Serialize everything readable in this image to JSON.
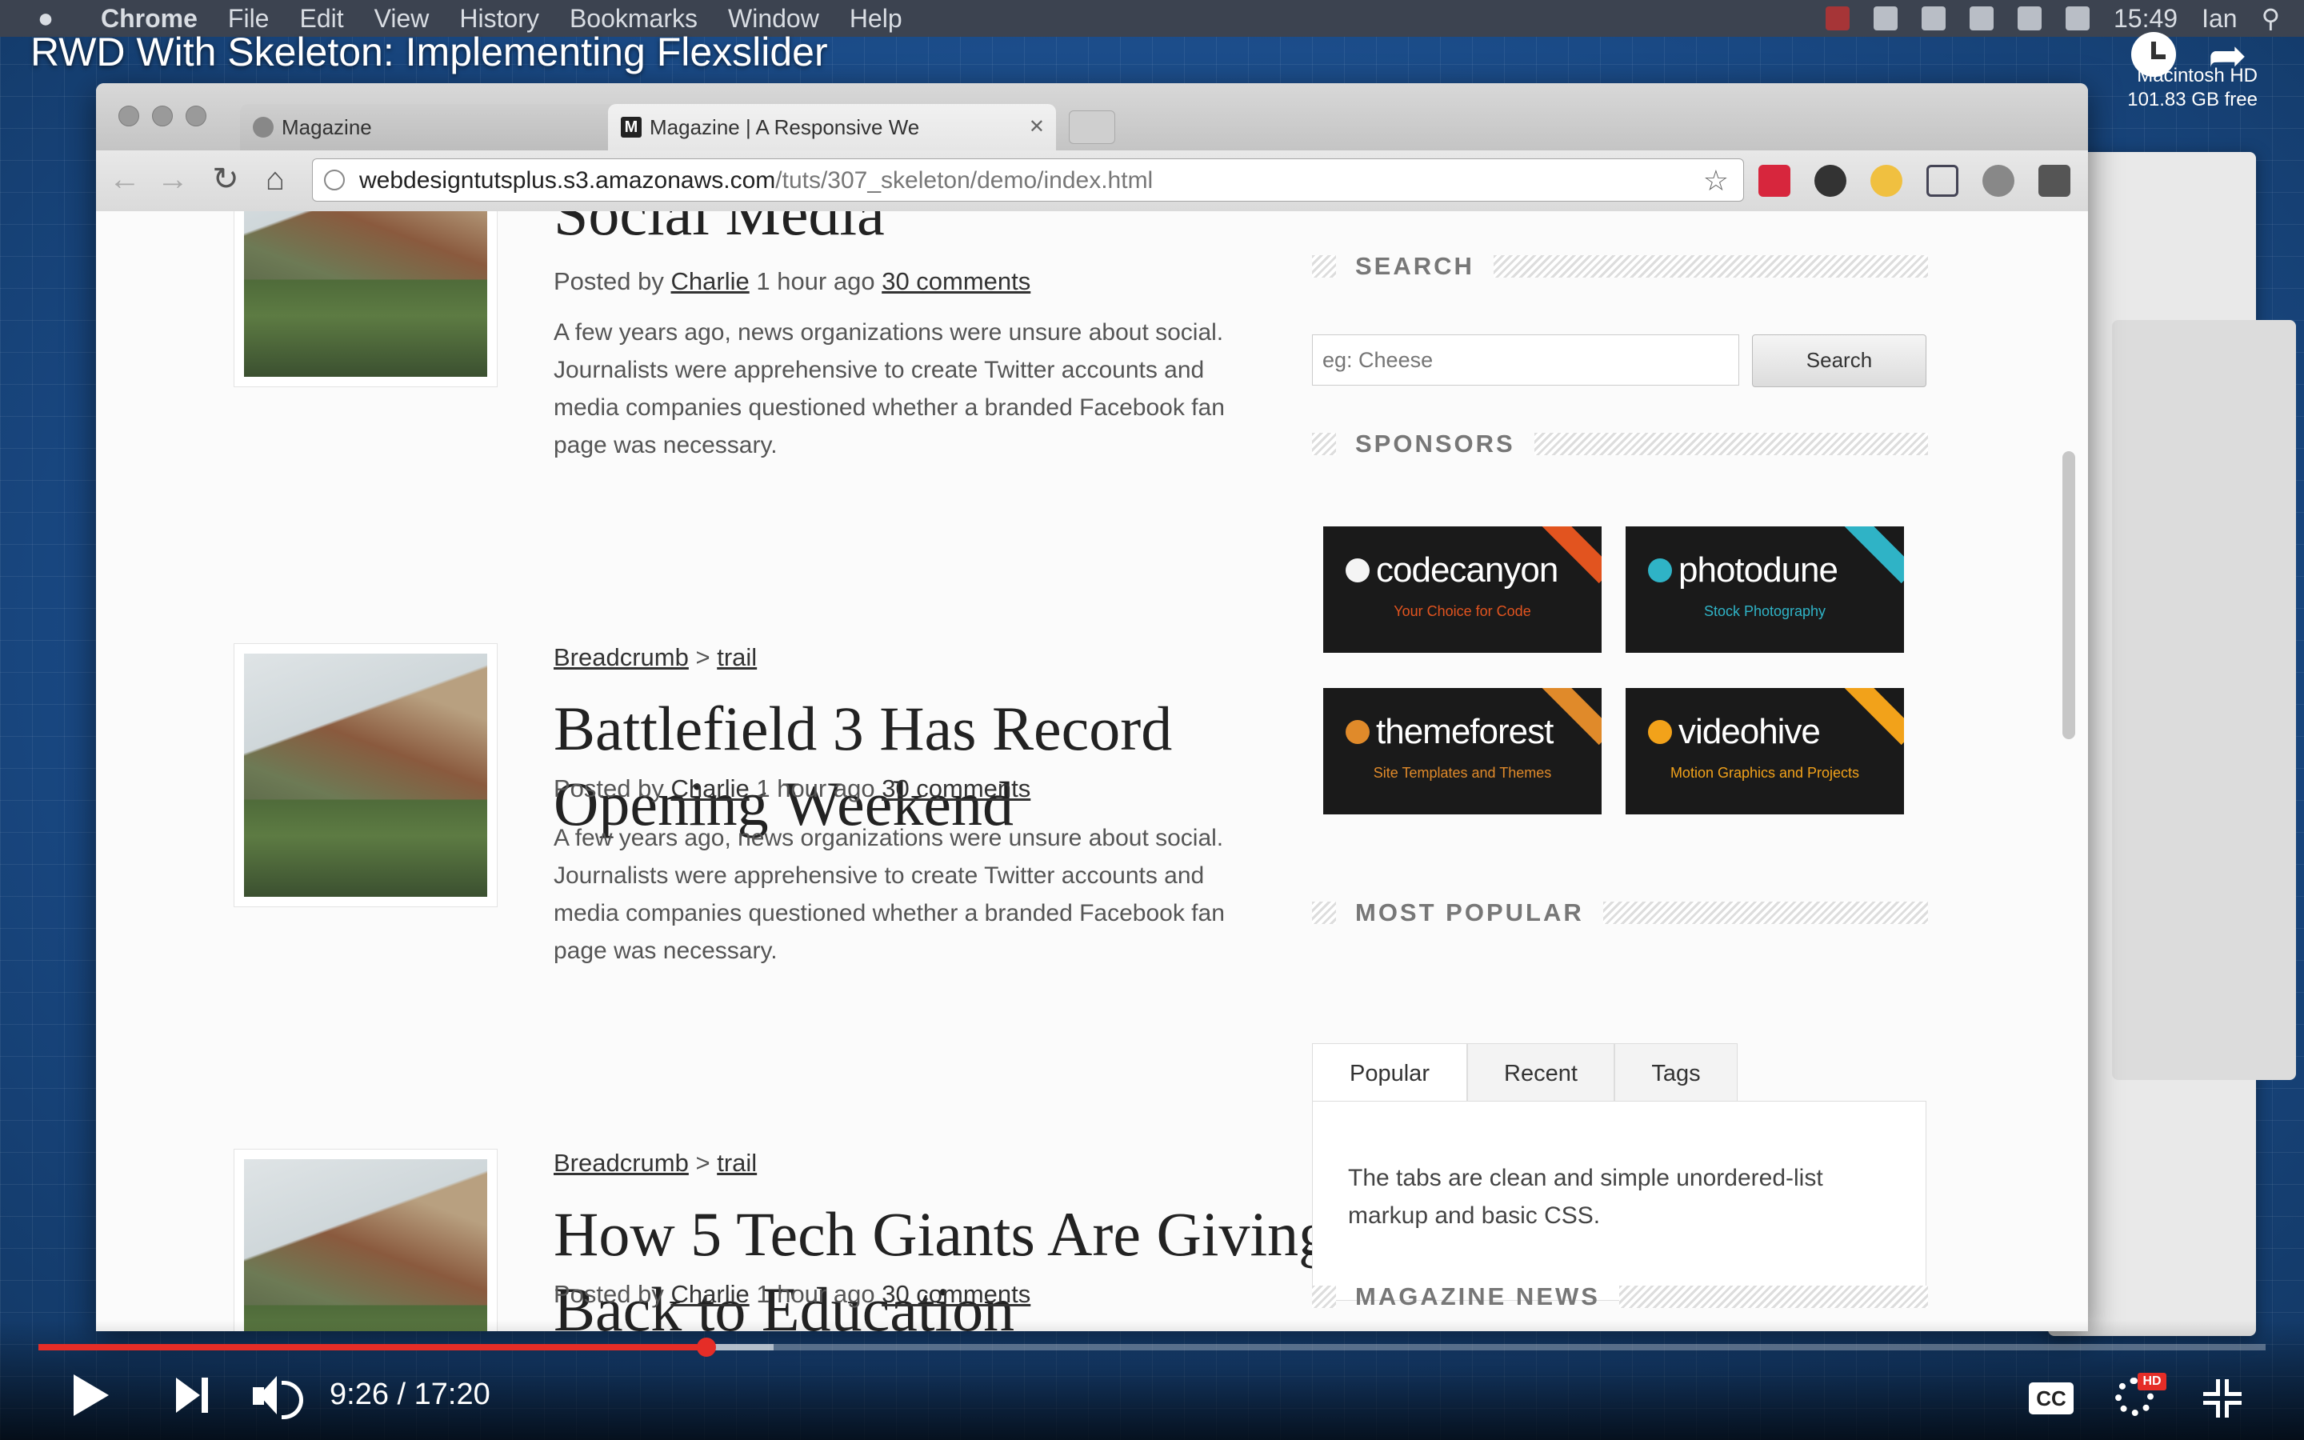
{
  "menubar": {
    "app": "Chrome",
    "items": [
      "File",
      "Edit",
      "View",
      "History",
      "Bookmarks",
      "Window",
      "Help"
    ],
    "clock": "15:49",
    "user": "Ian"
  },
  "video": {
    "title": "RWD With Skeleton: Implementing Flexslider",
    "time": "9:26 / 17:20",
    "played_fraction": 0.3,
    "buffered_fraction": 0.33,
    "cc_label": "CC",
    "hd_label": "HD"
  },
  "desktop": {
    "disk_name": "Macintosh HD",
    "disk_free": "101.83 GB free"
  },
  "browser": {
    "tabs": [
      {
        "title": "Magazine"
      },
      {
        "title": "Magazine | A Responsive We"
      }
    ],
    "url_host": "webdesigntutsplus.s3.amazonaws.com",
    "url_path": "/tuts/307_skeleton/demo/index.html"
  },
  "articles": [
    {
      "title": "Social Media",
      "posted_prefix": "Posted by",
      "author": "Charlie",
      "time": "1 hour ago",
      "comments": "30 comments",
      "excerpt": "A few years ago, news organizations were unsure about social. Journalists were apprehensive to create Twitter accounts and media companies questioned whether a branded Facebook fan page was necessary."
    },
    {
      "crumb_1": "Breadcrumb",
      "crumb_sep": ">",
      "crumb_2": "trail",
      "title": "Battlefield 3 Has Record Opening Weekend",
      "posted_prefix": "Posted by",
      "author": "Charlie",
      "time": "1 hour ago",
      "comments": "30 comments",
      "excerpt": "A few years ago, news organizations were unsure about social. Journalists were apprehensive to create Twitter accounts and media companies questioned whether a branded Facebook fan page was necessary."
    },
    {
      "crumb_1": "Breadcrumb",
      "crumb_sep": ">",
      "crumb_2": "trail",
      "title": "How 5 Tech Giants Are Giving Back to Education",
      "posted_prefix": "Posted by",
      "author": "Charlie",
      "time": "1 hour ago",
      "comments": "30 comments"
    }
  ],
  "sidebar": {
    "search_heading": "SEARCH",
    "search_placeholder": "eg: Cheese",
    "search_button": "Search",
    "sponsors_heading": "SPONSORS",
    "sponsors": [
      {
        "name": "codecanyon",
        "tagline": "Your Choice for Code",
        "color": "#e2541f"
      },
      {
        "name": "photodune",
        "tagline": "Stock Photography",
        "color": "#2fb3c6"
      },
      {
        "name": "themeforest",
        "tagline": "Site Templates and Themes",
        "color": "#e08a2a"
      },
      {
        "name": "videohive",
        "tagline": "Motion Graphics and Projects",
        "color": "#f2a21a"
      }
    ],
    "popular_heading": "MOST POPULAR",
    "tabs": [
      "Popular",
      "Recent",
      "Tags"
    ],
    "tab_content": "The tabs are clean and simple unordered-list markup and basic CSS.",
    "news_heading": "MAGAZINE NEWS"
  }
}
